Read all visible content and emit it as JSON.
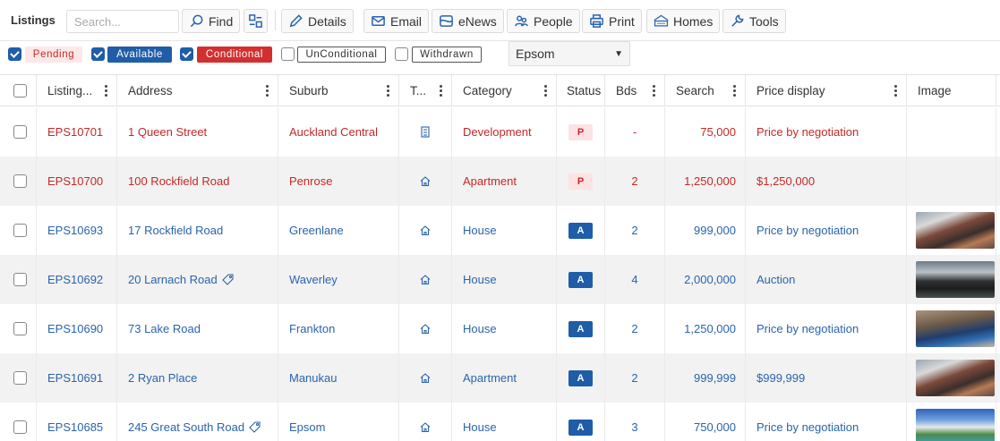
{
  "toolbar": {
    "title": "Listings",
    "search_placeholder": "Search...",
    "buttons": {
      "find": "Find",
      "details": "Details",
      "email": "Email",
      "enews": "eNews",
      "people": "People",
      "print": "Print",
      "homes": "Homes",
      "tools": "Tools"
    }
  },
  "filters": {
    "statuses": [
      {
        "label": "Pending",
        "checked": true,
        "bg": "#fde8e8",
        "color": "#c62828"
      },
      {
        "label": "Available",
        "checked": true,
        "bg": "#1f5da8",
        "color": "#ffffff"
      },
      {
        "label": "Conditional",
        "checked": true,
        "bg": "#d32f2f",
        "color": "#ffffff"
      },
      {
        "label": "UnConditional",
        "checked": false,
        "bg": "#ffffff",
        "color": "#333333"
      },
      {
        "label": "Withdrawn",
        "checked": false,
        "bg": "#ffffff",
        "color": "#333333"
      }
    ],
    "suburb_selected": "Epsom"
  },
  "columns": [
    "Listing...",
    "Address",
    "Suburb",
    "T...",
    "Category",
    "Status",
    "Bds",
    "Search",
    "Price display",
    "Image"
  ],
  "rows": [
    {
      "id": "EPS10701",
      "address": "1 Queen Street",
      "suburb": "Auckland Central",
      "type_icon": "building-icon",
      "category": "Development",
      "status": "P",
      "beds": "-",
      "search": "75,000",
      "price": "Price by negotiation",
      "image": "",
      "tagged": false,
      "state": "pending"
    },
    {
      "id": "EPS10700",
      "address": "100 Rockfield Road",
      "suburb": "Penrose",
      "type_icon": "house-icon",
      "category": "Apartment",
      "status": "P",
      "beds": "2",
      "search": "1,250,000",
      "price": "$1,250,000",
      "image": "",
      "tagged": false,
      "state": "pending"
    },
    {
      "id": "EPS10693",
      "address": "17 Rockfield Road",
      "suburb": "Greenlane",
      "type_icon": "house-icon",
      "category": "House",
      "status": "A",
      "beds": "2",
      "search": "999,000",
      "price": "Price by negotiation",
      "image": "apartment-photo",
      "tagged": false,
      "state": "available"
    },
    {
      "id": "EPS10692",
      "address": "20 Larnach Road",
      "suburb": "Waverley",
      "type_icon": "house-icon",
      "category": "House",
      "status": "A",
      "beds": "4",
      "search": "2,000,000",
      "price": "Auction",
      "image": "modern-house-photo",
      "tagged": true,
      "state": "available"
    },
    {
      "id": "EPS10690",
      "address": "73 Lake Road",
      "suburb": "Frankton",
      "type_icon": "house-icon",
      "category": "House",
      "status": "A",
      "beds": "2",
      "search": "1,250,000",
      "price": "Price by negotiation",
      "image": "pool-deck-photo",
      "tagged": false,
      "state": "available"
    },
    {
      "id": "EPS10691",
      "address": "2 Ryan Place",
      "suburb": "Manukau",
      "type_icon": "house-icon",
      "category": "Apartment",
      "status": "A",
      "beds": "2",
      "search": "999,999",
      "price": "$999,999",
      "image": "apartment-photo",
      "tagged": false,
      "state": "available"
    },
    {
      "id": "EPS10685",
      "address": "245 Great South Road",
      "suburb": "Epsom",
      "type_icon": "house-icon",
      "category": "House",
      "status": "A",
      "beds": "3",
      "search": "750,000",
      "price": "Price by negotiation",
      "image": "villa-pool-photo",
      "tagged": true,
      "state": "available"
    }
  ],
  "colors": {
    "pending_text": "#c62828",
    "available_text": "#2a64ad",
    "accent_blue": "#1f5da8",
    "accent_red": "#d32f2f"
  }
}
